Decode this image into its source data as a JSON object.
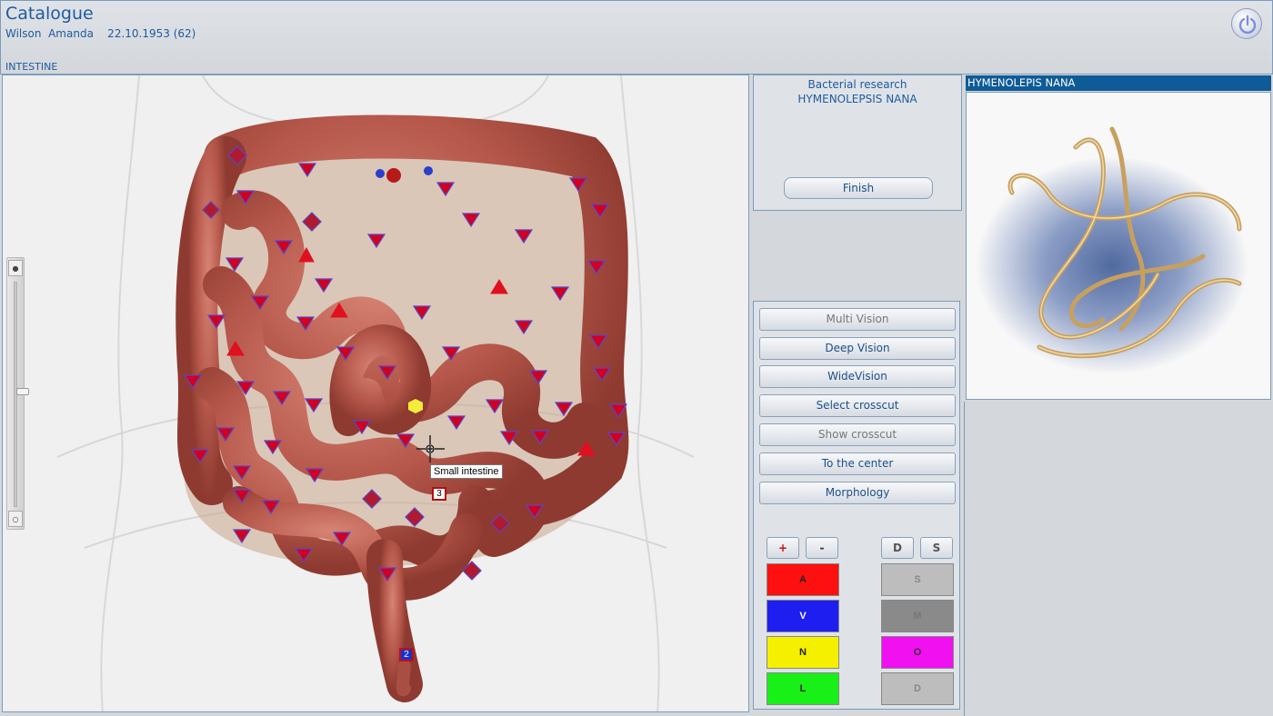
{
  "header": {
    "app_title": "Catalogue",
    "patient_line": "Wilson  Amanda    22.10.1953 (62)",
    "section": "INTESTINE",
    "power_icon": "power-icon"
  },
  "viewport": {
    "tooltip": "Small intestine",
    "marker_3": "3",
    "marker_2": "2",
    "zoom_in_glyph": "●",
    "zoom_out_glyph": "○"
  },
  "research": {
    "title": "Bacterial research",
    "subject": "HYMENOLEPSIS NANA",
    "finish_label": "Finish"
  },
  "vision_buttons": [
    {
      "label": "Multi Vision",
      "enabled": false
    },
    {
      "label": "Deep Vision",
      "enabled": true
    },
    {
      "label": "WideVision",
      "enabled": true
    },
    {
      "label": "Select crosscut",
      "enabled": true
    },
    {
      "label": "Show crosscut",
      "enabled": false
    },
    {
      "label": "To the center",
      "enabled": true
    },
    {
      "label": "Morphology",
      "enabled": true
    }
  ],
  "small_buttons": {
    "plus": "+",
    "minus": "-",
    "d": "D",
    "s": "S"
  },
  "swatches_left": [
    {
      "label": "A",
      "color": "#ff1010"
    },
    {
      "label": "V",
      "color": "#1e1ef0"
    },
    {
      "label": "N",
      "color": "#f4f000"
    },
    {
      "label": "L",
      "color": "#18f018"
    }
  ],
  "swatches_right": [
    {
      "label": "S",
      "color": "#bdbdbd"
    },
    {
      "label": "M",
      "color": "#8a8a8a"
    },
    {
      "label": "O",
      "color": "#f010f0"
    },
    {
      "label": "D",
      "color": "#bdbdbd"
    }
  ],
  "parasite": {
    "name": "HYMENOLEPIS NANA"
  }
}
